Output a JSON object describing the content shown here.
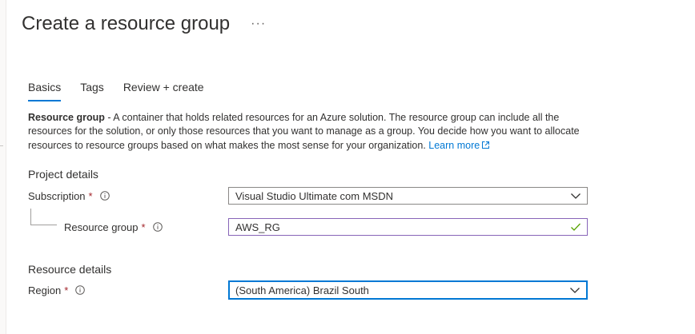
{
  "header": {
    "title": "Create a resource group",
    "more_label": "···"
  },
  "tabs": [
    {
      "label": "Basics",
      "active": true
    },
    {
      "label": "Tags",
      "active": false
    },
    {
      "label": "Review + create",
      "active": false
    }
  ],
  "description": {
    "term": "Resource group",
    "body": " - A container that holds related resources for an Azure solution. The resource group can include all the resources for the solution, or only those resources that you want to manage as a group. You decide how you want to allocate resources to resource groups based on what makes the most sense for your organization. ",
    "learn_more": "Learn more"
  },
  "project_details": {
    "heading": "Project details",
    "subscription": {
      "label": "Subscription",
      "required_mark": "*",
      "value": "Visual Studio Ultimate com MSDN"
    },
    "resource_group": {
      "label": "Resource group",
      "required_mark": "*",
      "value": "AWS_RG"
    }
  },
  "resource_details": {
    "heading": "Resource details",
    "region": {
      "label": "Region",
      "required_mark": "*",
      "value": "(South America) Brazil South"
    }
  },
  "colors": {
    "accent": "#0078d4",
    "required": "#a4262c",
    "valid": "#57a300",
    "valid_border": "#8764b8"
  },
  "icons": {
    "more": "ellipsis-icon",
    "info": "info-icon",
    "external": "external-link-icon",
    "dropdown": "chevron-down-icon",
    "valid": "checkmark-icon"
  }
}
